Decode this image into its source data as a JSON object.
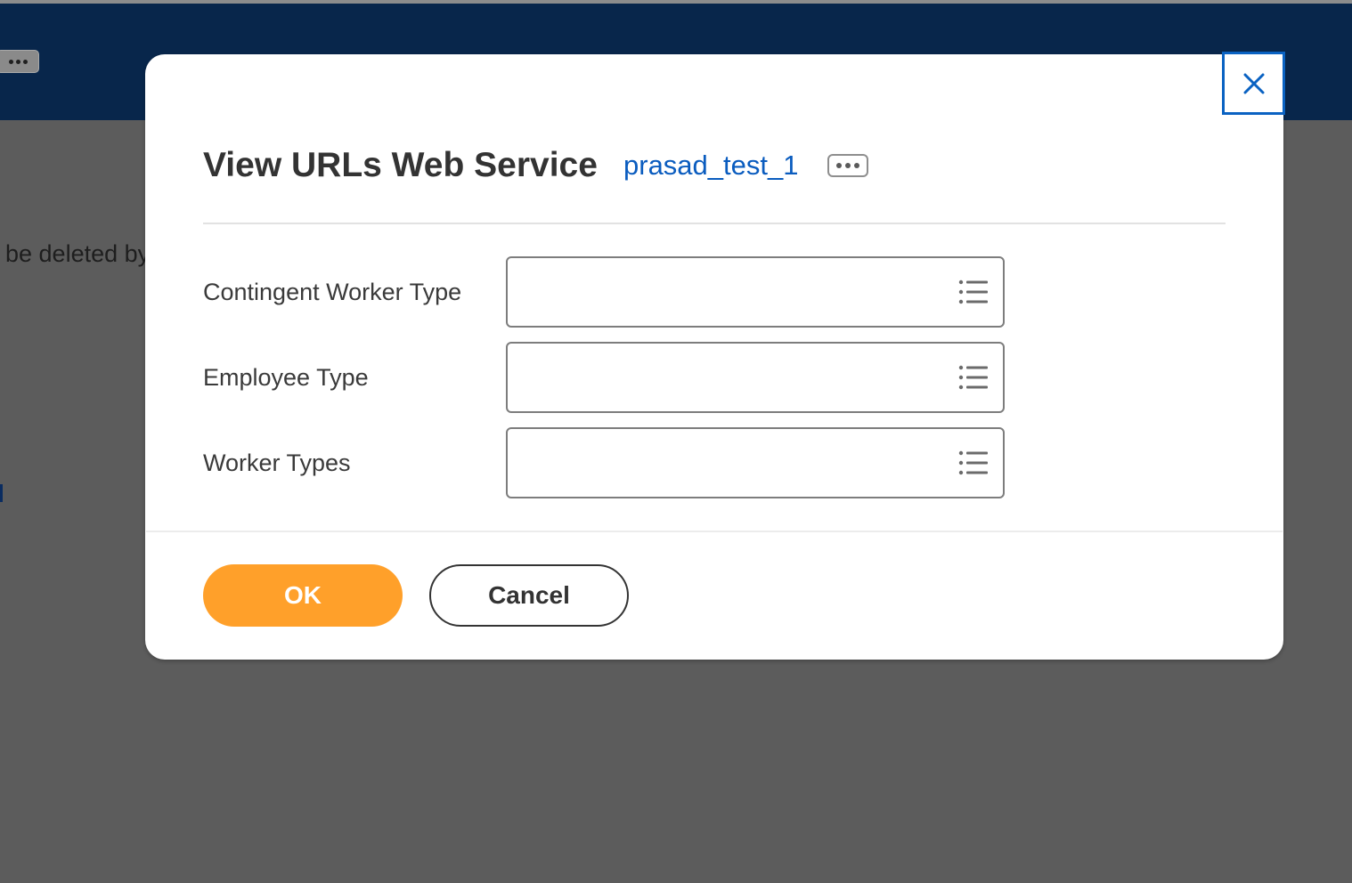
{
  "background": {
    "partial_text": "be deleted by",
    "header_more_icon": "ellipsis-icon"
  },
  "dialog": {
    "title": "View URLs Web Service",
    "related_link": "prasad_test_1",
    "related_actions_icon": "ellipsis-icon",
    "close_icon": "close-icon",
    "fields": [
      {
        "label": "Contingent Worker Type",
        "value": "",
        "icon": "list-prompt-icon"
      },
      {
        "label": "Employee Type",
        "value": "",
        "icon": "list-prompt-icon"
      },
      {
        "label": "Worker Types",
        "value": "",
        "icon": "list-prompt-icon"
      }
    ],
    "ok_label": "OK",
    "cancel_label": "Cancel"
  },
  "colors": {
    "header": "#08264b",
    "overlay": "#5c5c5c",
    "primary_button": "#ffa02a",
    "link": "#0a5cbf",
    "focus_ring": "#0a62c2"
  }
}
